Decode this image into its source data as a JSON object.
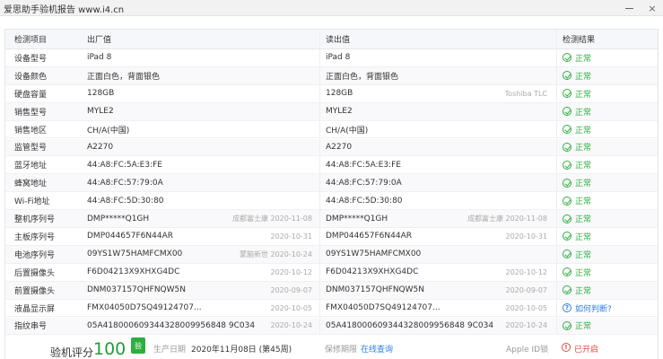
{
  "window": {
    "title": "爱思助手验机报告 www.i4.cn",
    "minimize_label": "",
    "close_label": "×"
  },
  "table": {
    "headers": {
      "item": "检测项目",
      "factory": "出厂值",
      "read": "读出值",
      "result": "检测结果"
    },
    "rows": [
      {
        "label": "设备型号",
        "factory": "iPad 8",
        "factory_note": "",
        "read": "iPad 8",
        "read_note": "",
        "result": "正常",
        "status": "ok"
      },
      {
        "label": "设备颜色",
        "factory": "正面白色，背面银色",
        "factory_note": "",
        "read": "正面白色，背面银色",
        "read_note": "",
        "result": "正常",
        "status": "ok"
      },
      {
        "label": "硬盘容量",
        "factory": "128GB",
        "factory_note": "",
        "read": "128GB",
        "read_note": "Toshiba TLC",
        "result": "正常",
        "status": "ok"
      },
      {
        "label": "销售型号",
        "factory": "MYLE2",
        "factory_note": "",
        "read": "MYLE2",
        "read_note": "",
        "result": "正常",
        "status": "ok"
      },
      {
        "label": "销售地区",
        "factory": "CH/A(中国)",
        "factory_note": "",
        "read": "CH/A(中国)",
        "read_note": "",
        "result": "正常",
        "status": "ok"
      },
      {
        "label": "监管型号",
        "factory": "A2270",
        "factory_note": "",
        "read": "A2270",
        "read_note": "",
        "result": "正常",
        "status": "ok"
      },
      {
        "label": "蓝牙地址",
        "factory": "44:A8:FC:5A:E3:FE",
        "factory_note": "",
        "read": "44:A8:FC:5A:E3:FE",
        "read_note": "",
        "result": "正常",
        "status": "ok"
      },
      {
        "label": "蜂窝地址",
        "factory": "44:A8:FC:57:79:0A",
        "factory_note": "",
        "read": "44:A8:FC:57:79:0A",
        "read_note": "",
        "result": "正常",
        "status": "ok"
      },
      {
        "label": "Wi-Fi地址",
        "factory": "44:A8:FC:5D:30:80",
        "factory_note": "",
        "read": "44:A8:FC:5D:30:80",
        "read_note": "",
        "result": "正常",
        "status": "ok"
      },
      {
        "label": "整机序列号",
        "factory": "DMP*****Q1GH",
        "factory_note": "成都富士康   2020-11-08",
        "read": "DMP*****Q1GH",
        "read_note": "成都富士康   2020-11-08",
        "result": "正常",
        "status": "ok"
      },
      {
        "label": "主板序列号",
        "factory": "DMP044657F6N44AR",
        "factory_note": "2020-10-31",
        "read": "DMP044657F6N44AR",
        "read_note": "2020-10-31",
        "result": "正常",
        "status": "ok"
      },
      {
        "label": "电池序列号",
        "factory": "09YS1W75HAMFCMX00",
        "factory_note": "蒙脑新世   2020-10-24",
        "read": "09YS1W75HAMFCMX00",
        "read_note": "",
        "result": "正常",
        "status": "ok"
      },
      {
        "label": "后置摄像头",
        "factory": "F6D04213X9XHXG4DC",
        "factory_note": "2020-10-12",
        "read": "F6D04213X9XHXG4DC",
        "read_note": "2020-10-12",
        "result": "正常",
        "status": "ok"
      },
      {
        "label": "前置摄像头",
        "factory": "DNM037157QHFNQW5N",
        "factory_note": "2020-09-07",
        "read": "DNM037157QHFNQW5N",
        "read_note": "2020-09-07",
        "result": "正常",
        "status": "ok"
      },
      {
        "label": "液晶显示屏",
        "factory": "FMX04050D7SQ49124707...",
        "factory_note": "2020-10-05",
        "read": "FMX04050D7SQ49124707...",
        "read_note": "2020-10-05",
        "result": "如何判断?",
        "status": "help"
      },
      {
        "label": "指纹串号",
        "factory": "05A418000609344328009956848 9C034",
        "factory_note": "2020-10-24",
        "read": "05A418000609344328009956848 9C034",
        "read_note": "2020-10-24",
        "result": "正常",
        "status": "ok"
      }
    ]
  },
  "footer": {
    "score_label": "验机评分",
    "score_value": "100",
    "score_badge": "验",
    "mfg_label": "生产日期",
    "mfg_value": "2020年11月08日 (第45周)",
    "warranty_label": "保修期限",
    "warranty_link": "在线查询",
    "appleid_label": "Apple ID锁",
    "appleid_status": "已开启"
  },
  "colors": {
    "ok": "#2fae3f",
    "warn": "#e04b3c",
    "link": "#2f7de1"
  }
}
